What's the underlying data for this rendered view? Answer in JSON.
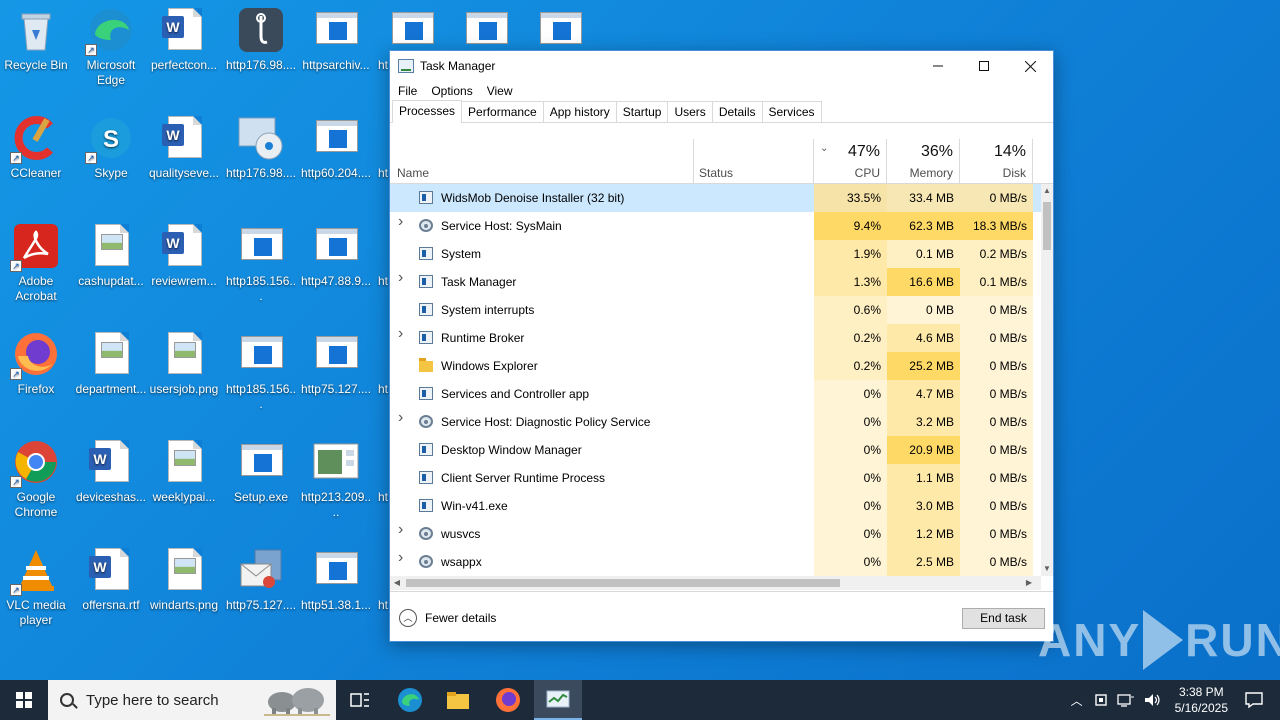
{
  "desktop": {
    "icons": [
      {
        "label": "Recycle Bin",
        "kind": "recycle"
      },
      {
        "label": "Microsoft Edge",
        "kind": "edge"
      },
      {
        "label": "perfectcon...",
        "kind": "word"
      },
      {
        "label": "http176.98....",
        "kind": "dark"
      },
      {
        "label": "httpsarchiv...",
        "kind": "html"
      },
      {
        "label": "CCleaner",
        "kind": "ccleaner"
      },
      {
        "label": "Skype",
        "kind": "skype"
      },
      {
        "label": "qualityseve...",
        "kind": "word"
      },
      {
        "label": "http176.98....",
        "kind": "disc"
      },
      {
        "label": "http60.204....",
        "kind": "html"
      },
      {
        "label": "Adobe Acrobat",
        "kind": "acrobat"
      },
      {
        "label": "cashupdat...",
        "kind": "image"
      },
      {
        "label": "reviewrem...",
        "kind": "word"
      },
      {
        "label": "http185.156...",
        "kind": "html"
      },
      {
        "label": "http47.88.9...",
        "kind": "html"
      },
      {
        "label": "Firefox",
        "kind": "firefox"
      },
      {
        "label": "department...",
        "kind": "image"
      },
      {
        "label": "usersjob.png",
        "kind": "image"
      },
      {
        "label": "http185.156...",
        "kind": "html"
      },
      {
        "label": "http75.127....",
        "kind": "html"
      },
      {
        "label": "Google Chrome",
        "kind": "chrome"
      },
      {
        "label": "deviceshas...",
        "kind": "word"
      },
      {
        "label": "weeklypai...",
        "kind": "image"
      },
      {
        "label": "Setup.exe",
        "kind": "html"
      },
      {
        "label": "http213.209....",
        "kind": "imgwin"
      },
      {
        "label": "VLC media player",
        "kind": "vlc"
      },
      {
        "label": "offersna.rtf",
        "kind": "word"
      },
      {
        "label": "windarts.png",
        "kind": "image"
      },
      {
        "label": "http75.127....",
        "kind": "mail"
      },
      {
        "label": "http51.38.1...",
        "kind": "html"
      }
    ],
    "partial_labels": [
      "ht",
      "ht",
      "ht",
      "ht",
      "ht",
      "ht"
    ]
  },
  "task_manager": {
    "title": "Task Manager",
    "menu": [
      "File",
      "Options",
      "View"
    ],
    "tabs": [
      "Processes",
      "Performance",
      "App history",
      "Startup",
      "Users",
      "Details",
      "Services"
    ],
    "active_tab": "Processes",
    "columns": {
      "name": "Name",
      "status": "Status",
      "cpu": {
        "pct": "47%",
        "label": "CPU"
      },
      "memory": {
        "pct": "36%",
        "label": "Memory"
      },
      "disk": {
        "pct": "14%",
        "label": "Disk"
      }
    },
    "processes": [
      {
        "name": "WidsMob Denoise Installer (32 bit)",
        "cpu": "33.5%",
        "memory": "33.4 MB",
        "disk": "0 MB/s",
        "expandable": false,
        "icon": "app",
        "selected": true
      },
      {
        "name": "Service Host: SysMain",
        "cpu": "9.4%",
        "memory": "62.3 MB",
        "disk": "18.3 MB/s",
        "expandable": true,
        "icon": "gear"
      },
      {
        "name": "System",
        "cpu": "1.9%",
        "memory": "0.1 MB",
        "disk": "0.2 MB/s",
        "expandable": false,
        "icon": "app"
      },
      {
        "name": "Task Manager",
        "cpu": "1.3%",
        "memory": "16.6 MB",
        "disk": "0.1 MB/s",
        "expandable": true,
        "icon": "taskmgr"
      },
      {
        "name": "System interrupts",
        "cpu": "0.6%",
        "memory": "0 MB",
        "disk": "0 MB/s",
        "expandable": false,
        "icon": "app"
      },
      {
        "name": "Runtime Broker",
        "cpu": "0.2%",
        "memory": "4.6 MB",
        "disk": "0 MB/s",
        "expandable": true,
        "icon": "app"
      },
      {
        "name": "Windows Explorer",
        "cpu": "0.2%",
        "memory": "25.2 MB",
        "disk": "0 MB/s",
        "expandable": false,
        "icon": "folder"
      },
      {
        "name": "Services and Controller app",
        "cpu": "0%",
        "memory": "4.7 MB",
        "disk": "0 MB/s",
        "expandable": false,
        "icon": "app"
      },
      {
        "name": "Service Host: Diagnostic Policy Service",
        "cpu": "0%",
        "memory": "3.2 MB",
        "disk": "0 MB/s",
        "expandable": true,
        "icon": "gear"
      },
      {
        "name": "Desktop Window Manager",
        "cpu": "0%",
        "memory": "20.9 MB",
        "disk": "0 MB/s",
        "expandable": false,
        "icon": "app"
      },
      {
        "name": "Client Server Runtime Process",
        "cpu": "0%",
        "memory": "1.1 MB",
        "disk": "0 MB/s",
        "expandable": false,
        "icon": "app"
      },
      {
        "name": "Win-v41.exe",
        "cpu": "0%",
        "memory": "3.0 MB",
        "disk": "0 MB/s",
        "expandable": false,
        "icon": "app"
      },
      {
        "name": "wusvcs",
        "cpu": "0%",
        "memory": "1.2 MB",
        "disk": "0 MB/s",
        "expandable": true,
        "icon": "gear"
      },
      {
        "name": "wsappx",
        "cpu": "0%",
        "memory": "2.5 MB",
        "disk": "0 MB/s",
        "expandable": true,
        "icon": "gear"
      }
    ],
    "footer": {
      "fewer_details": "Fewer details",
      "end_task": "End task"
    }
  },
  "taskbar": {
    "search_placeholder": "Type here to search",
    "time": "3:38 PM",
    "date": "5/16/2025"
  },
  "watermark": {
    "left": "ANY",
    "right": "RUN"
  },
  "colors": {
    "desktop": "#0f7fd6",
    "taskbar": "#1c2a3a",
    "selected_row": "#cce8ff",
    "heat_high": "#ffe9a8",
    "heat_mid": "#fff0c4",
    "heat_low": "#fff4d6"
  }
}
